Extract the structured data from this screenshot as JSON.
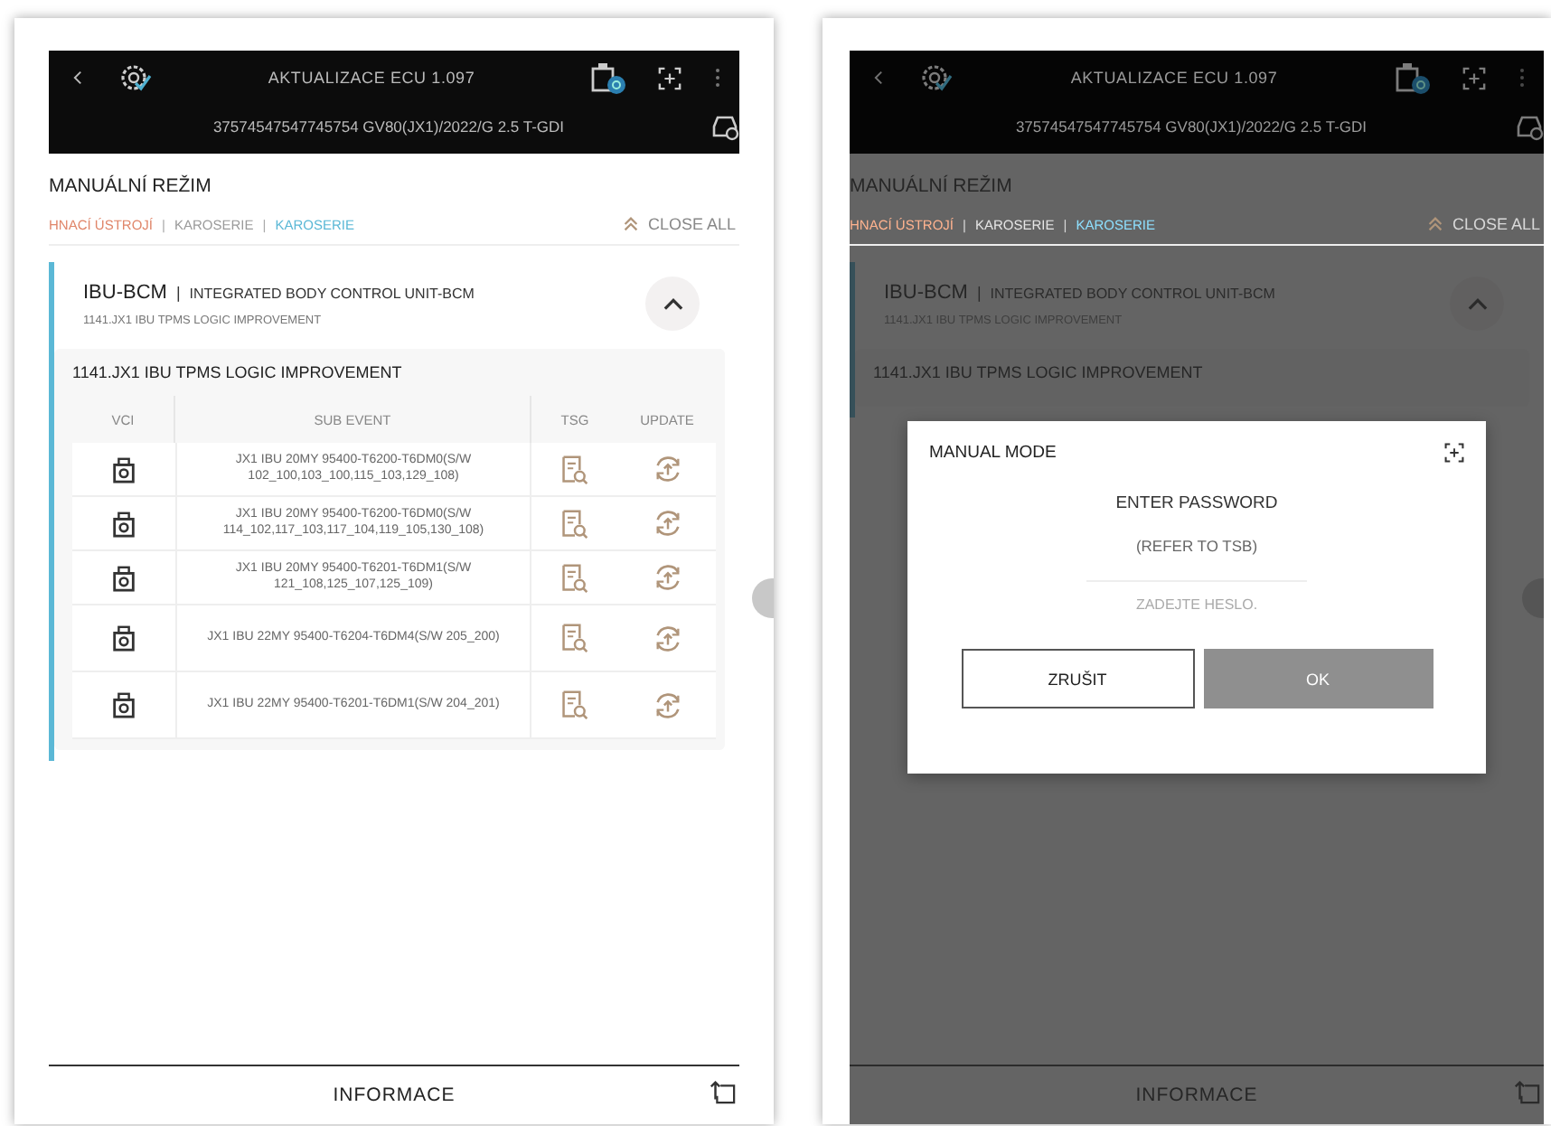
{
  "screens": [
    {
      "header": {
        "title": "AKTUALIZACE ECU 1.097",
        "vin": "37574547547745754 GV80(JX1)/2022/G 2.5 T-GDI"
      },
      "section_title": "MANUÁLNÍ REŽIM",
      "breadcrumbs": [
        {
          "label": "HNACÍ ÚSTROJÍ",
          "color": "#e0866a"
        },
        {
          "separator": "|"
        },
        {
          "label": "KAROSERIE",
          "color": "#9a9a9a"
        },
        {
          "separator": "|"
        },
        {
          "label": "KAROSERIE",
          "color": "#5bb8d6"
        }
      ],
      "close_all": "CLOSE ALL",
      "card": {
        "code": "IBU-BCM",
        "separator": "|",
        "name": "INTEGRATED BODY CONTROL UNIT-BCM",
        "subtitle": "1141.JX1 IBU TPMS LOGIC IMPROVEMENT",
        "expanded": true,
        "event_title": "1141.JX1 IBU TPMS LOGIC IMPROVEMENT",
        "columns": [
          "VCI",
          "SUB EVENT",
          "TSG",
          "UPDATE"
        ],
        "rows": [
          {
            "event": "JX1 IBU 20MY 95400-T6200-T6DM0(S/W 102_100,103_100,115_103,129_108)"
          },
          {
            "event": "JX1 IBU 20MY 95400-T6200-T6DM0(S/W 114_102,117_103,117_104,119_105,130_108)"
          },
          {
            "event": "JX1 IBU 20MY 95400-T6201-T6DM1(S/W 121_108,125_107,125_109)"
          },
          {
            "event": "JX1 IBU 22MY 95400-T6204-T6DM4(S/W 205_200)"
          },
          {
            "event": "JX1 IBU 22MY 95400-T6201-T6DM1(S/W 204_201)"
          }
        ]
      },
      "footer": "INFORMACE"
    },
    {
      "header": {
        "title": "AKTUALIZACE ECU 1.097",
        "vin": "37574547547745754 GV80(JX1)/2022/G 2.5 T-GDI"
      },
      "section_title": "MANUÁLNÍ REŽIM",
      "breadcrumbs": [
        {
          "label": "HNACÍ ÚSTROJÍ",
          "color": "#ffb38f"
        },
        {
          "separator": "|"
        },
        {
          "label": "KAROSERIE",
          "color": "#e6e6e6"
        },
        {
          "separator": "|"
        },
        {
          "label": "KAROSERIE",
          "color": "#8ee0ff"
        }
      ],
      "close_all": "CLOSE ALL",
      "card": {
        "code": "IBU-BCM",
        "separator": "|",
        "name": "INTEGRATED BODY CONTROL UNIT-BCM",
        "subtitle": "1141.JX1 IBU TPMS LOGIC IMPROVEMENT",
        "expanded": true,
        "event_title": "1141.JX1 IBU TPMS LOGIC IMPROVEMENT"
      },
      "footer": "INFORMACE",
      "dialog": {
        "title": "MANUAL MODE",
        "prompt": "ENTER PASSWORD",
        "hint": "(REFER TO TSB)",
        "placeholder": "ZADEJTE HESLO.",
        "cancel": "ZRUŠIT",
        "ok": "OK",
        "ok_disabled": true
      }
    }
  ]
}
